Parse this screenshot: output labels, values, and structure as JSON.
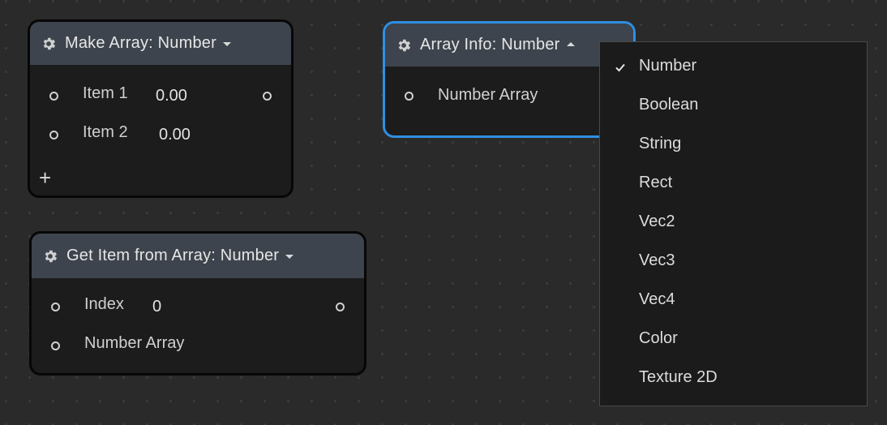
{
  "nodes": {
    "make_array": {
      "title": "Make Array: Number",
      "items": [
        {
          "label": "Item 1",
          "value": "0.00"
        },
        {
          "label": "Item 2",
          "value": "0.00"
        }
      ],
      "add_label": "+"
    },
    "array_info": {
      "title": "Array Info: Number",
      "input_label": "Number Array"
    },
    "get_item": {
      "title": "Get Item from Array: Number",
      "index_label": "Index",
      "index_value": "0",
      "array_label": "Number Array"
    }
  },
  "type_dropdown": {
    "selected": "Number",
    "options": [
      "Number",
      "Boolean",
      "String",
      "Rect",
      "Vec2",
      "Vec3",
      "Vec4",
      "Color",
      "Texture 2D"
    ]
  },
  "colors": {
    "canvas": "#2a2a2a",
    "node_body": "#1c1c1c",
    "node_header": "#3d444d",
    "selection": "#2f8fe3",
    "menu_bg": "#1b1b1b"
  }
}
